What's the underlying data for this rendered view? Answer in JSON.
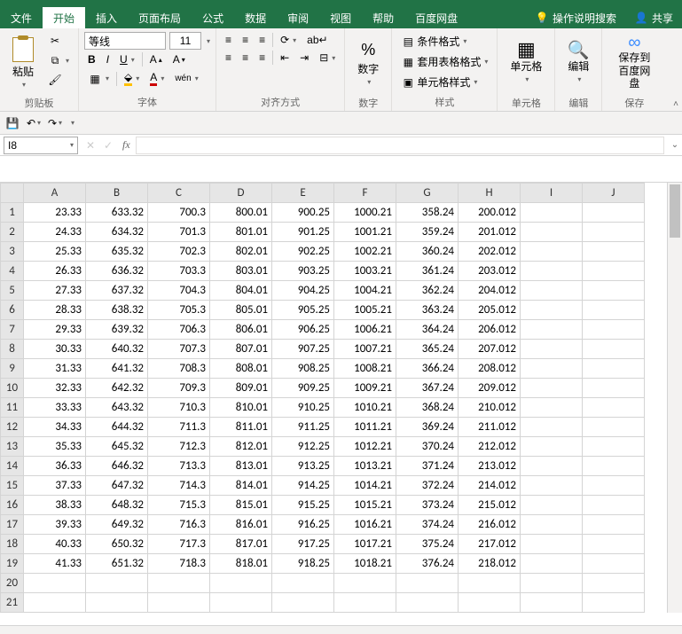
{
  "tabs": {
    "file": "文件",
    "home": "开始",
    "insert": "插入",
    "layout": "页面布局",
    "formula": "公式",
    "data": "数据",
    "review": "审阅",
    "view": "视图",
    "help": "帮助",
    "baidu": "百度网盘",
    "tellme": "操作说明搜索",
    "share": "共享"
  },
  "ribbon": {
    "clipboard": "剪贴板",
    "paste": "粘贴",
    "font_group": "字体",
    "font_name": "等线",
    "font_size": "11",
    "align_group": "对齐方式",
    "number_group": "数字",
    "number_btn": "数字",
    "styles_group": "样式",
    "cond_fmt": "条件格式",
    "table_fmt": "套用表格格式",
    "cell_style": "单元格样式",
    "cells_group": "单元格",
    "cells_btn": "单元格",
    "edit_group": "编辑",
    "edit_btn": "编辑",
    "save_group": "保存",
    "save_btn": "保存到百度网盘"
  },
  "namebox": "I8",
  "columns": [
    "A",
    "B",
    "C",
    "D",
    "E",
    "F",
    "G",
    "H",
    "I",
    "J"
  ],
  "rows": [
    1,
    2,
    3,
    4,
    5,
    6,
    7,
    8,
    9,
    10,
    11,
    12,
    13,
    14,
    15,
    16,
    17,
    18,
    19,
    20,
    21
  ],
  "chart_data": {
    "type": "table",
    "columns": [
      "A",
      "B",
      "C",
      "D",
      "E",
      "F",
      "G",
      "H"
    ],
    "rows": [
      [
        "23.33",
        "633.32",
        "700.3",
        "800.01",
        "900.25",
        "1000.21",
        "358.24",
        "200.012"
      ],
      [
        "24.33",
        "634.32",
        "701.3",
        "801.01",
        "901.25",
        "1001.21",
        "359.24",
        "201.012"
      ],
      [
        "25.33",
        "635.32",
        "702.3",
        "802.01",
        "902.25",
        "1002.21",
        "360.24",
        "202.012"
      ],
      [
        "26.33",
        "636.32",
        "703.3",
        "803.01",
        "903.25",
        "1003.21",
        "361.24",
        "203.012"
      ],
      [
        "27.33",
        "637.32",
        "704.3",
        "804.01",
        "904.25",
        "1004.21",
        "362.24",
        "204.012"
      ],
      [
        "28.33",
        "638.32",
        "705.3",
        "805.01",
        "905.25",
        "1005.21",
        "363.24",
        "205.012"
      ],
      [
        "29.33",
        "639.32",
        "706.3",
        "806.01",
        "906.25",
        "1006.21",
        "364.24",
        "206.012"
      ],
      [
        "30.33",
        "640.32",
        "707.3",
        "807.01",
        "907.25",
        "1007.21",
        "365.24",
        "207.012"
      ],
      [
        "31.33",
        "641.32",
        "708.3",
        "808.01",
        "908.25",
        "1008.21",
        "366.24",
        "208.012"
      ],
      [
        "32.33",
        "642.32",
        "709.3",
        "809.01",
        "909.25",
        "1009.21",
        "367.24",
        "209.012"
      ],
      [
        "33.33",
        "643.32",
        "710.3",
        "810.01",
        "910.25",
        "1010.21",
        "368.24",
        "210.012"
      ],
      [
        "34.33",
        "644.32",
        "711.3",
        "811.01",
        "911.25",
        "1011.21",
        "369.24",
        "211.012"
      ],
      [
        "35.33",
        "645.32",
        "712.3",
        "812.01",
        "912.25",
        "1012.21",
        "370.24",
        "212.012"
      ],
      [
        "36.33",
        "646.32",
        "713.3",
        "813.01",
        "913.25",
        "1013.21",
        "371.24",
        "213.012"
      ],
      [
        "37.33",
        "647.32",
        "714.3",
        "814.01",
        "914.25",
        "1014.21",
        "372.24",
        "214.012"
      ],
      [
        "38.33",
        "648.32",
        "715.3",
        "815.01",
        "915.25",
        "1015.21",
        "373.24",
        "215.012"
      ],
      [
        "39.33",
        "649.32",
        "716.3",
        "816.01",
        "916.25",
        "1016.21",
        "374.24",
        "216.012"
      ],
      [
        "40.33",
        "650.32",
        "717.3",
        "817.01",
        "917.25",
        "1017.21",
        "375.24",
        "217.012"
      ],
      [
        "41.33",
        "651.32",
        "718.3",
        "818.01",
        "918.25",
        "1018.21",
        "376.24",
        "218.012"
      ],
      [
        "",
        "",
        "",
        "",
        "",
        "",
        "",
        ""
      ],
      [
        "",
        "",
        "",
        "",
        "",
        "",
        "",
        ""
      ]
    ]
  }
}
